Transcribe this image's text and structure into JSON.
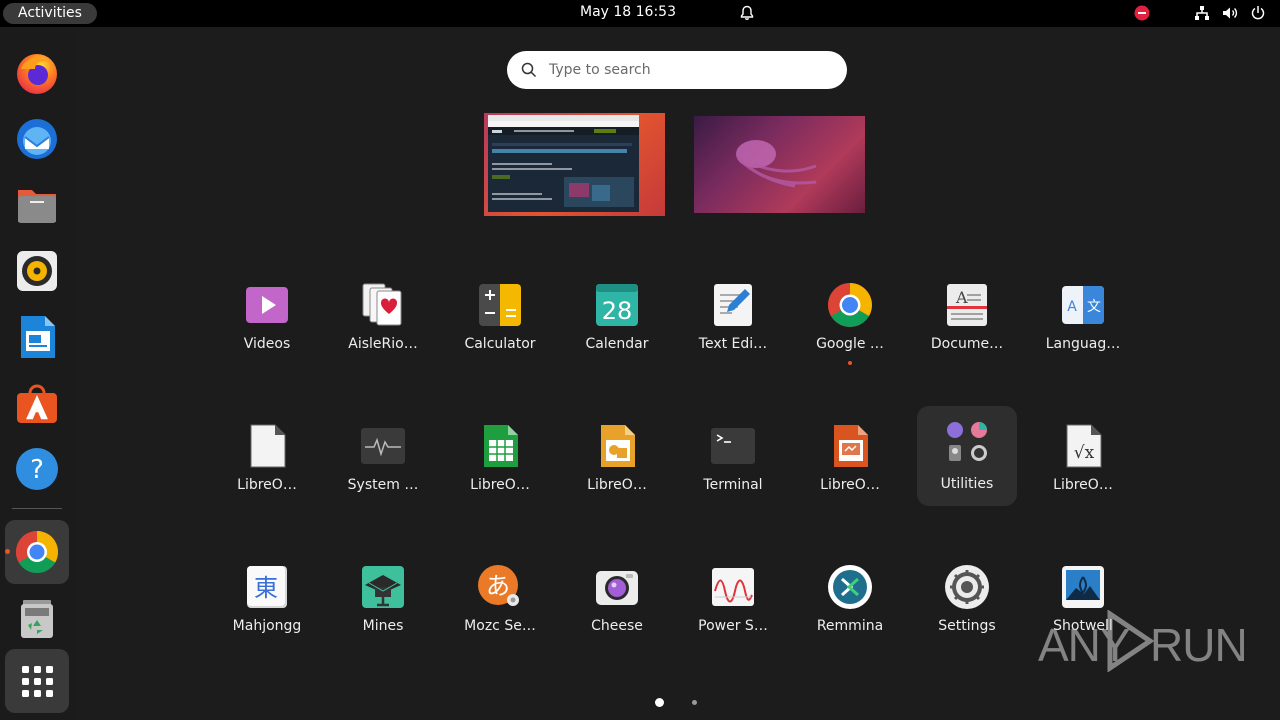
{
  "topbar": {
    "activities_label": "Activities",
    "clock": "May 18  16:53"
  },
  "search": {
    "placeholder": "Type to search"
  },
  "apps": [
    {
      "label": "Videos"
    },
    {
      "label": "AisleRio…"
    },
    {
      "label": "Calculator"
    },
    {
      "label": "Calendar",
      "day": "28"
    },
    {
      "label": "Text Edi…"
    },
    {
      "label": "Google …"
    },
    {
      "label": "Docume…"
    },
    {
      "label": "Languag…"
    },
    {
      "label": "LibreO…"
    },
    {
      "label": "System …"
    },
    {
      "label": "LibreO…"
    },
    {
      "label": "LibreO…"
    },
    {
      "label": "Terminal"
    },
    {
      "label": "LibreO…"
    },
    {
      "label": "Utilities"
    },
    {
      "label": "LibreO…"
    },
    {
      "label": "Mahjongg",
      "glyph": "東"
    },
    {
      "label": "Mines"
    },
    {
      "label": "Mozc Se…",
      "glyph": "あ"
    },
    {
      "label": "Cheese"
    },
    {
      "label": "Power S…"
    },
    {
      "label": "Remmina"
    },
    {
      "label": "Settings"
    },
    {
      "label": "Shotwell"
    }
  ],
  "pagination": {
    "pages": 2,
    "current": 1
  },
  "watermark": {
    "left": "ANY",
    "right": "RUN"
  },
  "colors": {
    "accent": "#e95420",
    "panel": "#000000",
    "overview_bg": "#1c1c1c",
    "dock_bg": "#1b1b1b"
  }
}
